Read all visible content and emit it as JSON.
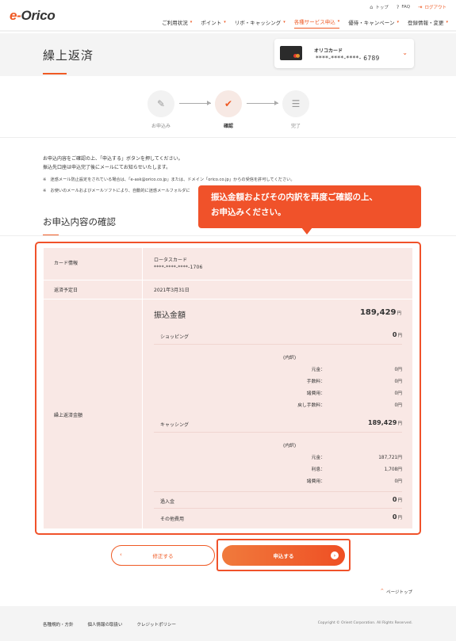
{
  "header": {
    "logo_e": "e-",
    "logo_text": "Orico",
    "util": [
      {
        "icon": "home-icon",
        "glyph": "⌂",
        "label": "トップ"
      },
      {
        "icon": "question-icon",
        "glyph": "?",
        "label": "FAQ"
      },
      {
        "icon": "logout-icon",
        "glyph": "⇥",
        "label": "ログアウト"
      }
    ],
    "nav": [
      "ご利用状況",
      "ポイント",
      "リボ・キャッシング",
      "各種サービス申込",
      "優待・キャンペーン",
      "登録情報・変更"
    ]
  },
  "title": {
    "text": "繰上返済",
    "card_name": "オリコカード",
    "card_number": "****-****-****- 6789"
  },
  "steps": [
    {
      "label": "お申込み",
      "glyph": "✎"
    },
    {
      "label": "確認",
      "glyph": "✔"
    },
    {
      "label": "完了",
      "glyph": "☰"
    }
  ],
  "intro": {
    "line1": "お申込内容をご確認の上、「申込する」ボタンを押してください。",
    "line2": "振込先口座は申込完了後にメールにてお知らせいたします。",
    "note1": "※　迷惑メール防止設定をされている場合は、「e-ask@orico.co.jp」または、ドメイン「orico.co.jp」からの受信を許可してください。",
    "note2": "※　お使いのメールおよびメールソフトにより、自動的に迷惑メールフォルダに"
  },
  "callout": {
    "line1": "振込金額およびその内訳を再度ご確認の上、",
    "line2": "お申込みください。"
  },
  "section": {
    "title": "お申込内容の確認"
  },
  "table": {
    "card_info_label": "カード情報",
    "card_info_name": "ロータスカード",
    "card_info_number": "****-****-****-1706",
    "date_label": "返済予定日",
    "date_value": "2021年3月31日",
    "amount_label": "繰上返済金額",
    "transfer_label": "振込金額",
    "transfer_value": "189,429",
    "yen": "円",
    "shopping_label": "ショッピング",
    "shopping_value": "0",
    "breakdown": "(内訳)",
    "shop_detail": [
      {
        "k": "元金：",
        "v": "0円"
      },
      {
        "k": "手数料：",
        "v": "0円"
      },
      {
        "k": "諸費用：",
        "v": "0円"
      },
      {
        "k": "戻し手数料：",
        "v": "0円"
      }
    ],
    "cashing_label": "キャッシング",
    "cashing_value": "189,429",
    "cash_detail": [
      {
        "k": "元金：",
        "v": "187,721円"
      },
      {
        "k": "利息：",
        "v": "1,708円"
      },
      {
        "k": "諸費用：",
        "v": "0円"
      }
    ],
    "overpay_label": "過入金",
    "overpay_value": "0",
    "other_label": "その他費用",
    "other_value": "0"
  },
  "buttons": {
    "back": "修正する",
    "back_icon": "‹",
    "submit": "申込する",
    "submit_icon": "›"
  },
  "pagetop": {
    "icon": "^",
    "label": "ページトップ"
  },
  "footer": {
    "links": [
      "各種規約・方針",
      "個人情報の取扱い",
      "クレジットポリシー"
    ],
    "copyright": "Copyright © Orient Corporation. All Rights Reserved."
  }
}
